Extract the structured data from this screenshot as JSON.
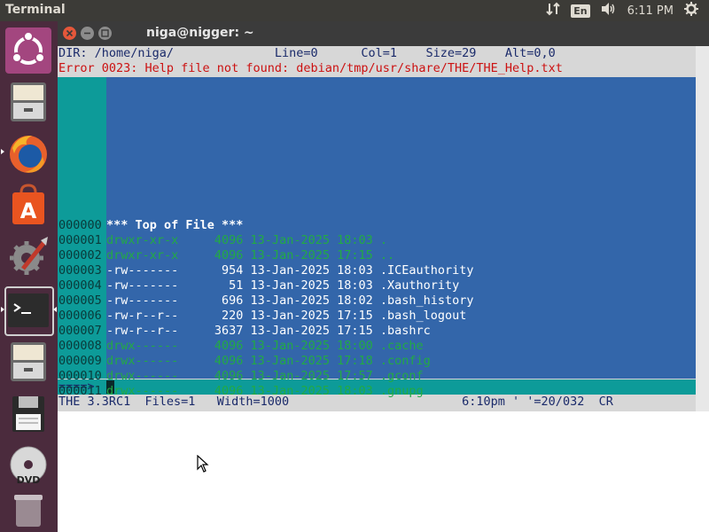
{
  "topbar": {
    "app_title": "Terminal",
    "language": "En",
    "clock": "6:11 PM",
    "icons": [
      "network-icon",
      "keyboard-language-icon",
      "volume-icon",
      "system-gear-icon"
    ]
  },
  "launcher": {
    "items": [
      {
        "name": "ubuntu-dash-icon"
      },
      {
        "name": "files-icon"
      },
      {
        "name": "firefox-icon"
      },
      {
        "name": "software-center-icon"
      },
      {
        "name": "system-settings-icon"
      },
      {
        "name": "terminal-icon"
      },
      {
        "name": "files-icon-2"
      },
      {
        "name": "floppy-save-icon"
      },
      {
        "name": "dvd-icon"
      },
      {
        "name": "trash-icon"
      }
    ]
  },
  "window": {
    "title": "niga@nigger: ~"
  },
  "editor": {
    "header": "DIR: /home/niga/              Line=0      Col=1    Size=29    Alt=0,0",
    "error": "Error 0023: Help file not found: debian/tmp/usr/share/THE/THE_Help.txt",
    "top_of_file_id": "000000",
    "top_of_file": "*** Top of File ***",
    "rows": [
      {
        "id": "000001",
        "text": "drwxr-xr-x     4096 13-Jan-2025 18:03 .",
        "style": "green"
      },
      {
        "id": "000002",
        "text": "drwxr-xr-x     4096 13-Jan-2025 17:15 ..",
        "style": "green"
      },
      {
        "id": "000003",
        "text": "-rw-------      954 13-Jan-2025 18:03 .ICEauthority",
        "style": "white"
      },
      {
        "id": "000004",
        "text": "-rw-------       51 13-Jan-2025 18:03 .Xauthority",
        "style": "white"
      },
      {
        "id": "000005",
        "text": "-rw-------      696 13-Jan-2025 18:02 .bash_history",
        "style": "white"
      },
      {
        "id": "000006",
        "text": "-rw-r--r--      220 13-Jan-2025 17:15 .bash_logout",
        "style": "white"
      },
      {
        "id": "000007",
        "text": "-rw-r--r--     3637 13-Jan-2025 17:15 .bashrc",
        "style": "white"
      },
      {
        "id": "000008",
        "text": "drwx------     4096 13-Jan-2025 18:00 .cache",
        "style": "green"
      },
      {
        "id": "000009",
        "text": "drwx------     4096 13-Jan-2025 17:18 .config",
        "style": "green"
      },
      {
        "id": "000010",
        "text": "drwx------     4096 13-Jan-2025 17:57 .gconf",
        "style": "green"
      },
      {
        "id": "000011",
        "text": "drwx------     4096 13-Jan-2025 18:03 .gnupg",
        "style": "green"
      }
    ],
    "prompt": "====>",
    "status": "THE 3.3RC1  Files=1   Width=1000                        6:10pm ' '=20/032  CR"
  }
}
